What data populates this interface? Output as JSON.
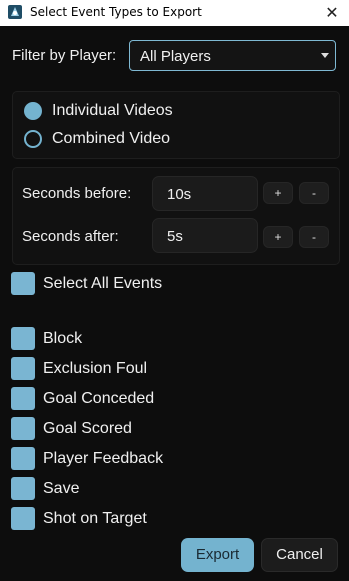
{
  "window": {
    "title": "Select Event Types to Export",
    "close_glyph": "✕",
    "icon": "app-icon"
  },
  "filter": {
    "label": "Filter by Player:",
    "selected": "All Players"
  },
  "video_mode": {
    "options": [
      {
        "label": "Individual Videos",
        "selected": true
      },
      {
        "label": "Combined Video",
        "selected": false
      }
    ]
  },
  "timing": {
    "before_label": "Seconds before:",
    "before_value": "10s",
    "after_label": "Seconds after:",
    "after_value": "5s",
    "plus": "+",
    "minus": "-"
  },
  "select_all": {
    "label": "Select All Events"
  },
  "events": [
    {
      "label": "Block"
    },
    {
      "label": "Exclusion Foul"
    },
    {
      "label": "Goal Conceded"
    },
    {
      "label": "Goal Scored"
    },
    {
      "label": "Player Feedback"
    },
    {
      "label": "Save"
    },
    {
      "label": "Shot on Target"
    }
  ],
  "buttons": {
    "export": "Export",
    "cancel": "Cancel"
  },
  "colors": {
    "accent": "#74b3cf",
    "background": "#0d0d0d"
  }
}
